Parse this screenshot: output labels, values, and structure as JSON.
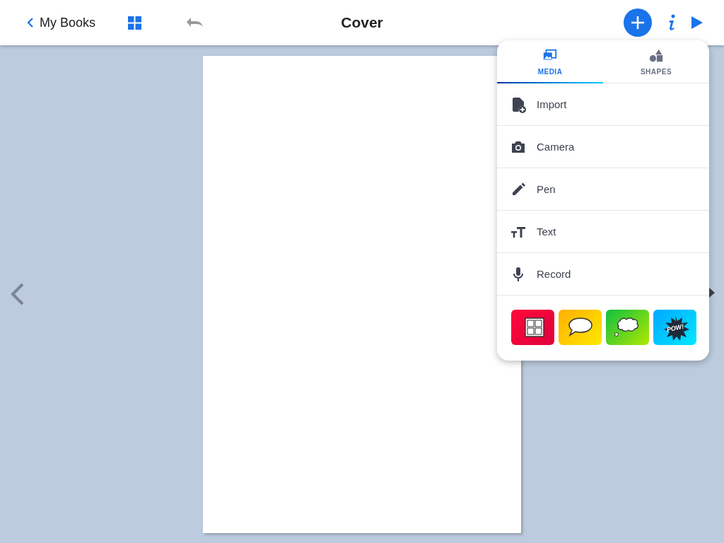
{
  "header": {
    "back_label": "My Books",
    "title": "Cover"
  },
  "menu": {
    "tabs": [
      {
        "label": "MEDIA",
        "kind": "media",
        "selected": true
      },
      {
        "label": "SHAPES",
        "kind": "shapes",
        "selected": false
      }
    ],
    "items": [
      {
        "label": "Import",
        "kind": "import"
      },
      {
        "label": "Camera",
        "kind": "camera"
      },
      {
        "label": "Pen",
        "kind": "pen"
      },
      {
        "label": "Text",
        "kind": "text"
      },
      {
        "label": "Record",
        "kind": "record"
      }
    ],
    "stickers": [
      {
        "kind": "panels"
      },
      {
        "kind": "speech"
      },
      {
        "kind": "thought"
      },
      {
        "kind": "pow",
        "text": "POW!"
      }
    ]
  }
}
